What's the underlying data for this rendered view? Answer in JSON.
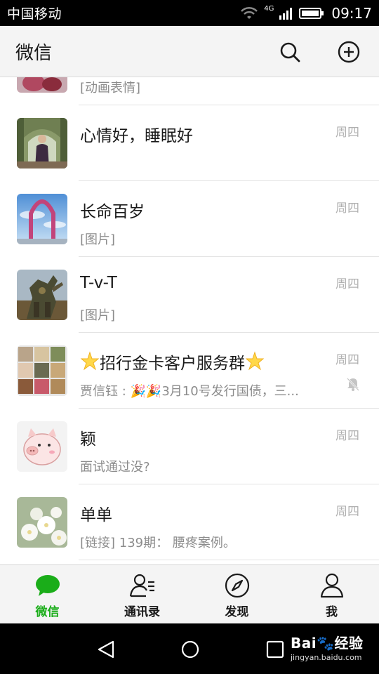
{
  "status_bar": {
    "carrier": "中国移动",
    "network": "4G",
    "time": "09:17"
  },
  "header": {
    "title": "微信",
    "search_icon": "search-icon",
    "add_icon": "plus-circle-icon"
  },
  "chats": [
    {
      "name": "",
      "preview": "[动画表情]",
      "time": "",
      "avatar": "avatar-partial"
    },
    {
      "name": "心情好，睡眠好",
      "preview": "",
      "time": "周四",
      "avatar": "avatar-garden"
    },
    {
      "name": "长命百岁",
      "preview": "[图片]",
      "time": "周四",
      "avatar": "avatar-arch"
    },
    {
      "name": "T-v-T",
      "preview": "[图片]",
      "time": "周四",
      "avatar": "avatar-robot"
    },
    {
      "name": "招行金卡客户服务群",
      "preview": "贾信钰 : 🎉🎉3月10号发行国债，三...",
      "time": "周四",
      "avatar": "avatar-grid",
      "muted": true
    },
    {
      "name": "颖",
      "preview": "面试通过没?",
      "time": "周四",
      "avatar": "avatar-pig"
    },
    {
      "name": "单单",
      "preview": "[链接] 139期： 腰疼案例。",
      "time": "周四",
      "avatar": "avatar-flowers"
    }
  ],
  "tabs": [
    {
      "label": "微信",
      "icon": "chat-bubble-icon",
      "active": true
    },
    {
      "label": "通讯录",
      "icon": "contacts-icon",
      "active": false
    },
    {
      "label": "发现",
      "icon": "compass-icon",
      "active": false
    },
    {
      "label": "我",
      "icon": "person-icon",
      "active": false
    }
  ],
  "watermark": {
    "main": "Bai🐾经验",
    "sub": "jingyan.baidu.com"
  },
  "colors": {
    "accent": "#1aad19",
    "header_bg": "#f4f4f4",
    "secondary_text": "#8c8c8c"
  }
}
